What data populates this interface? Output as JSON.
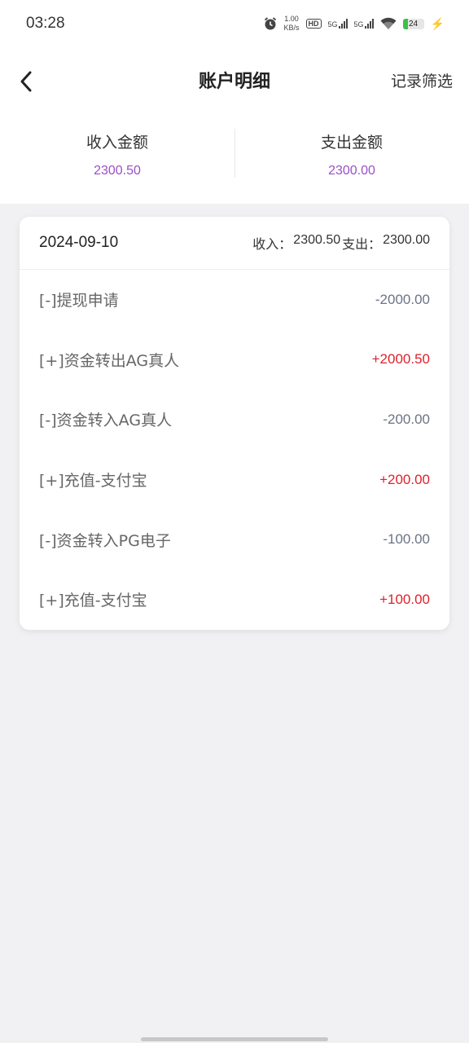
{
  "status": {
    "time": "03:28",
    "net_speed_value": "1.00",
    "net_speed_unit": "KB/s",
    "hd_label": "HD",
    "sim1": "5G",
    "sim2": "5G",
    "battery": "24",
    "battery_level": 0.24
  },
  "header": {
    "title": "账户明细",
    "action_label": "记录筛选"
  },
  "summary": {
    "income_label": "收入金额",
    "income_value": "2300.50",
    "expense_label": "支出金额",
    "expense_value": "2300.00"
  },
  "card": {
    "date": "2024-09-10",
    "income_prefix": "收入：",
    "income_total": "2300.50",
    "expense_prefix": "支出：",
    "expense_total": "2300.00",
    "rows": [
      {
        "label": "[-]提现申请",
        "amount": "-2000.00"
      },
      {
        "label": "[+]资金转出AG真人",
        "amount": "+2000.50"
      },
      {
        "label": "[-]资金转入AG真人",
        "amount": "-200.00"
      },
      {
        "label": "[+]充值-支付宝",
        "amount": "+200.00"
      },
      {
        "label": "[-]资金转入PG电子",
        "amount": "-100.00"
      },
      {
        "label": "[+]充值-支付宝",
        "amount": "+100.00"
      }
    ]
  },
  "colors": {
    "summary_value": "#9b4fc7",
    "positive": "#e0202a",
    "negative": "#6b7385"
  }
}
